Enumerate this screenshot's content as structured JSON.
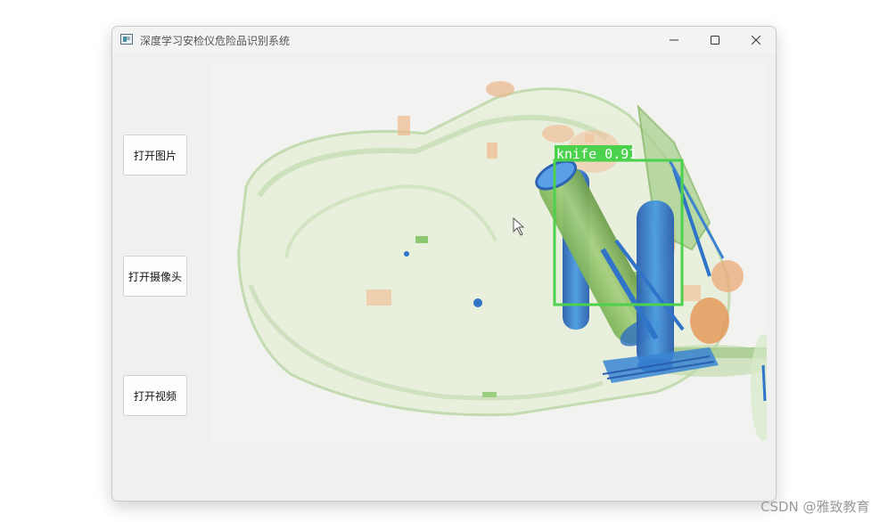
{
  "window": {
    "title": "深度学习安检仪危险品识别系统",
    "controls": {
      "minimize_icon": "minimize-icon",
      "maximize_icon": "maximize-icon",
      "close_icon": "close-icon"
    }
  },
  "sidebar": {
    "buttons": [
      {
        "label": "打开图片"
      },
      {
        "label": "打开摄像头"
      },
      {
        "label": "打开视频"
      }
    ]
  },
  "detection": {
    "label": "knife 0.91",
    "box_color": "#4cd14c"
  },
  "colors": {
    "window_bg": "#f0f0f0",
    "xray_bg": "#f2f3f1",
    "xray_green": "#9cc98a",
    "xray_blue": "#2f74c9",
    "xray_orange": "#e9a66f"
  },
  "watermark": "CSDN @雅致教育"
}
